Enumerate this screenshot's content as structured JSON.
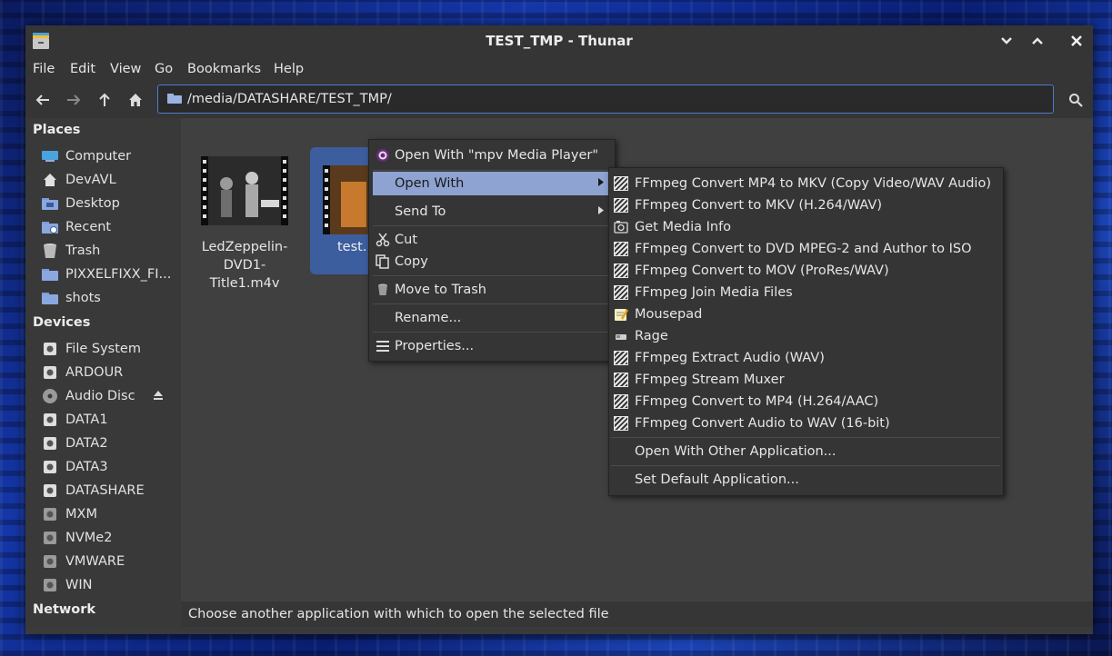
{
  "window": {
    "title": "TEST_TMP - Thunar"
  },
  "menubar": [
    "File",
    "Edit",
    "View",
    "Go",
    "Bookmarks",
    "Help"
  ],
  "location": {
    "path": "/media/DATASHARE/TEST_TMP/"
  },
  "sidebar": {
    "places_heading": "Places",
    "places": [
      {
        "label": "Computer",
        "icon": "computer-icon"
      },
      {
        "label": "DevAVL",
        "icon": "home-icon"
      },
      {
        "label": "Desktop",
        "icon": "desktop-folder-icon"
      },
      {
        "label": "Recent",
        "icon": "recent-folder-icon"
      },
      {
        "label": "Trash",
        "icon": "trash-icon"
      },
      {
        "label": "PIXXELFIXX_FI...",
        "icon": "folder-icon"
      },
      {
        "label": "shots",
        "icon": "folder-icon"
      }
    ],
    "devices_heading": "Devices",
    "devices": [
      {
        "label": "File System",
        "icon": "drive-icon"
      },
      {
        "label": "ARDOUR",
        "icon": "drive-icon"
      },
      {
        "label": "Audio Disc",
        "icon": "disc-icon"
      },
      {
        "label": "DATA1",
        "icon": "drive-icon"
      },
      {
        "label": "DATA2",
        "icon": "drive-icon"
      },
      {
        "label": "DATA3",
        "icon": "drive-icon"
      },
      {
        "label": "DATASHARE",
        "icon": "drive-icon"
      },
      {
        "label": "MXM",
        "icon": "drive-icon"
      },
      {
        "label": "NVMe2",
        "icon": "drive-icon"
      },
      {
        "label": "VMWARE",
        "icon": "drive-icon"
      },
      {
        "label": "WIN",
        "icon": "drive-icon"
      }
    ],
    "network_heading": "Network"
  },
  "files": [
    {
      "name_line1": "LedZeppelin-",
      "name_line2": "DVD1-Title1.m4v"
    },
    {
      "name_line1": "test."
    }
  ],
  "context_menu": {
    "open_with_default": "Open With \"mpv Media Player\"",
    "open_with": "Open With",
    "send_to": "Send To",
    "cut": "Cut",
    "copy": "Copy",
    "move_to_trash": "Move to Trash",
    "rename": "Rename...",
    "properties": "Properties..."
  },
  "submenu": {
    "apps": [
      {
        "label": "FFmpeg Convert MP4 to MKV (Copy Video/WAV Audio)",
        "icon": "ffmpeg-icon"
      },
      {
        "label": "FFmpeg Convert to MKV (H.264/WAV)",
        "icon": "ffmpeg-icon"
      },
      {
        "label": "Get Media Info",
        "icon": "media-info-icon"
      },
      {
        "label": "FFmpeg Convert to DVD MPEG-2 and Author to ISO",
        "icon": "ffmpeg-icon"
      },
      {
        "label": "FFmpeg Convert to MOV (ProRes/WAV)",
        "icon": "ffmpeg-icon"
      },
      {
        "label": "FFmpeg Join Media Files",
        "icon": "ffmpeg-icon"
      },
      {
        "label": "Mousepad",
        "icon": "mousepad-icon"
      },
      {
        "label": "Rage",
        "icon": "rage-icon"
      },
      {
        "label": "FFmpeg Extract Audio (WAV)",
        "icon": "ffmpeg-icon"
      },
      {
        "label": "FFmpeg Stream Muxer",
        "icon": "ffmpeg-icon"
      },
      {
        "label": "FFmpeg Convert to MP4 (H.264/AAC)",
        "icon": "ffmpeg-icon"
      },
      {
        "label": "FFmpeg Convert Audio to WAV (16-bit)",
        "icon": "ffmpeg-icon"
      }
    ],
    "other_app": "Open With Other Application...",
    "set_default": "Set Default Application..."
  },
  "statusbar": {
    "text": "Choose another application with which to open the selected file"
  },
  "colors": {
    "accent": "#4e7bcf",
    "highlight": "#8ea3d2",
    "window_bg": "#3a3a3a"
  }
}
